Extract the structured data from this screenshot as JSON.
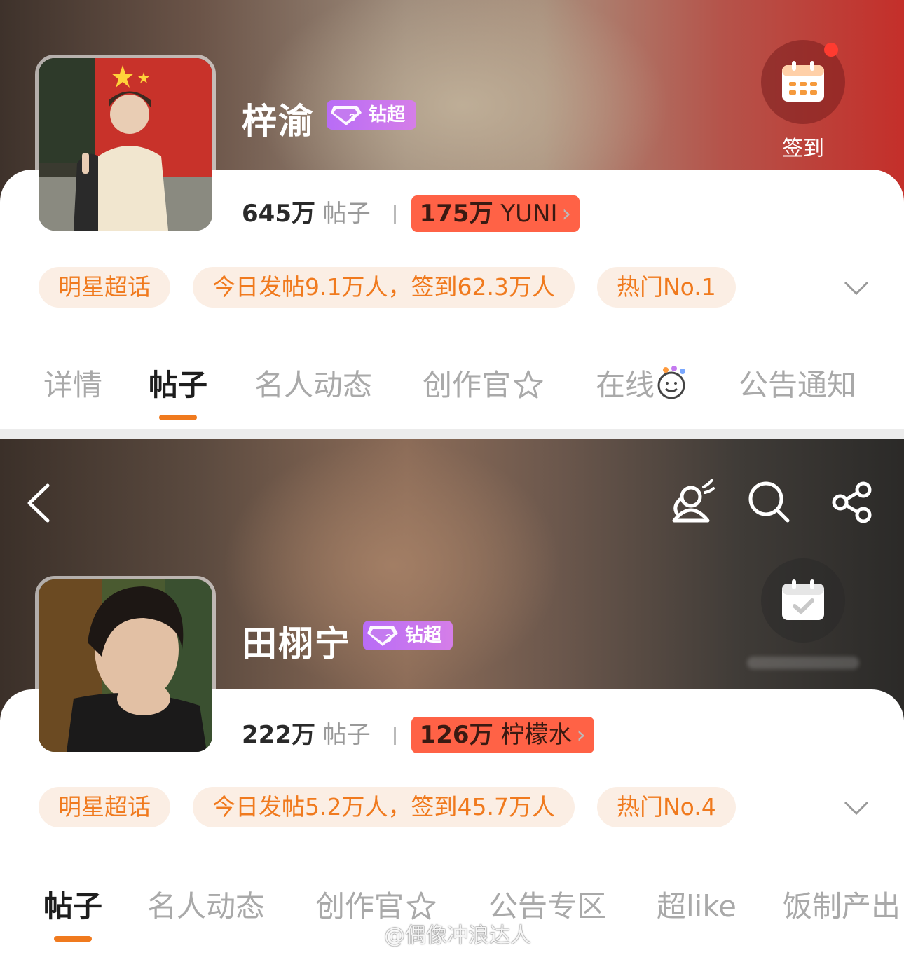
{
  "panel1": {
    "name": "梓渝",
    "badge": "钻超",
    "checkin_label": "签到",
    "posts_num": "645万",
    "posts_label": "帖子",
    "fans_num": "175万",
    "fans_label": "YUNI",
    "tags": [
      "明星超话",
      "今日发帖9.1万人，签到62.3万人",
      "热门No.1"
    ],
    "tabs": [
      "详情",
      "帖子",
      "名人动态",
      "创作官",
      "在线",
      "公告通知"
    ],
    "active_tab": "帖子"
  },
  "panel2": {
    "name": "田栩宁",
    "badge": "钻超",
    "posts_num": "222万",
    "posts_label": "帖子",
    "fans_num": "126万",
    "fans_label": "柠檬水",
    "tags": [
      "明星超话",
      "今日发帖5.2万人，签到45.7万人",
      "热门No.4"
    ],
    "tabs": [
      "帖子",
      "名人动态",
      "创作官",
      "公告专区",
      "超like",
      "饭制产出"
    ],
    "active_tab": "帖子"
  },
  "watermark": "@偶像冲浪达人",
  "colors": {
    "accent_orange": "#f07a1e",
    "tag_bg": "#fbeee4",
    "badge_purple": "#c070f0",
    "highlight_red": "#ff5a3c"
  },
  "icons": [
    "calendar-icon",
    "calendar-check-icon",
    "back-arrow-icon",
    "user-follow-icon",
    "search-icon",
    "share-icon",
    "chevron-down-icon",
    "diamond-icon",
    "weibo-logo-icon"
  ]
}
